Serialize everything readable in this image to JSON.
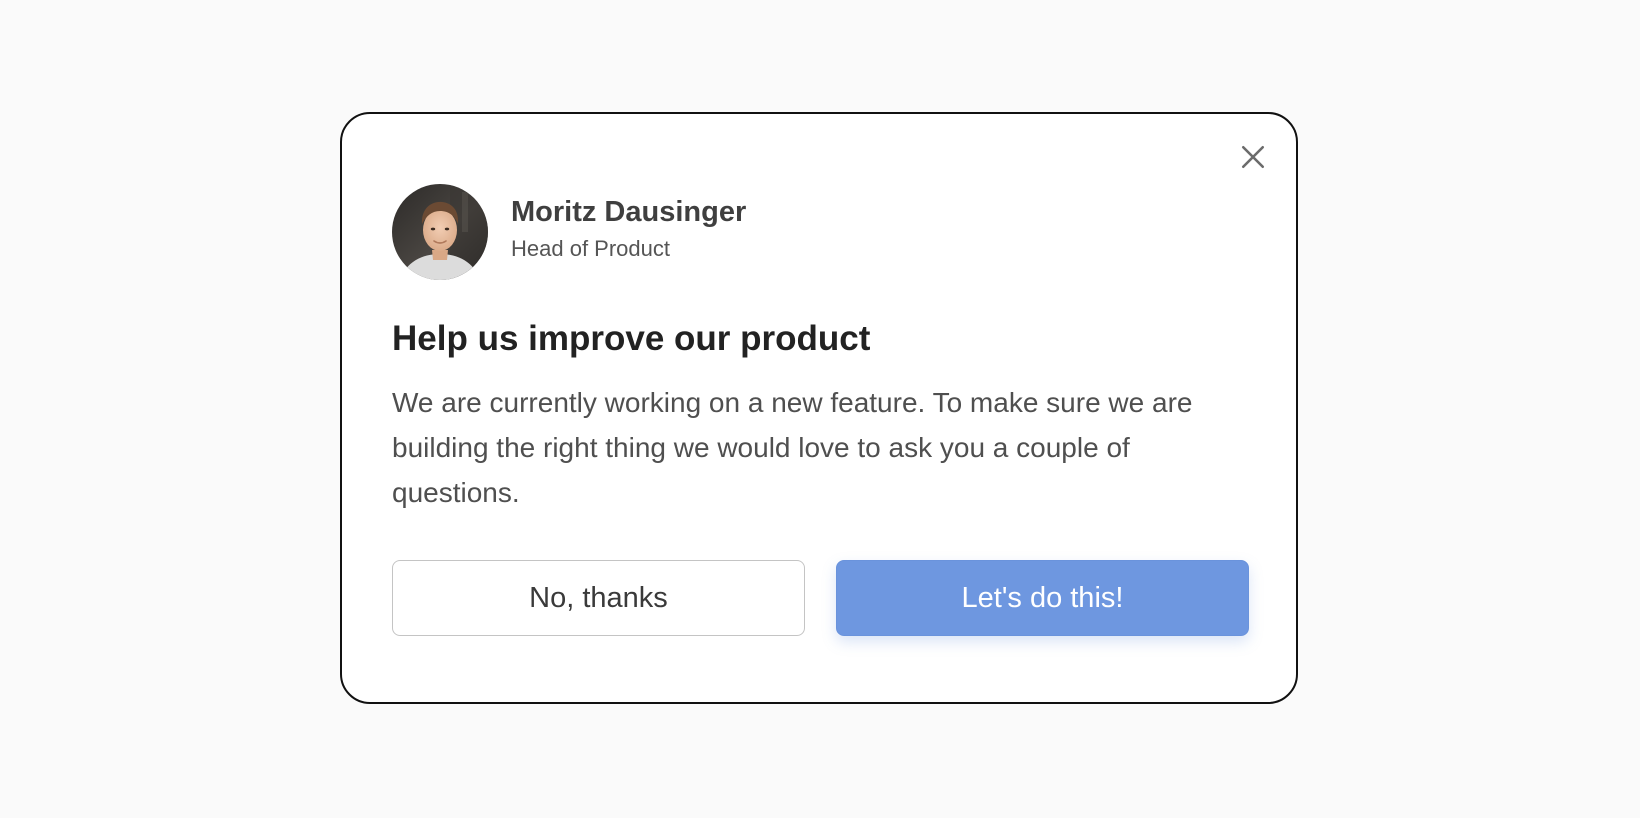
{
  "modal": {
    "close_icon": "close-icon",
    "author": {
      "avatar_icon": "avatar-photo",
      "name": "Moritz Dausinger",
      "role": "Head of Product"
    },
    "title": "Help us improve our product",
    "body": "We are currently working on a new feature. To make sure we are building the right thing we would love to ask you a couple of questions.",
    "buttons": {
      "decline_label": "No, thanks",
      "accept_label": "Let's do this!"
    }
  },
  "colors": {
    "background": "#fafafa",
    "modal_border": "#111111",
    "primary_button": "#6e97e0",
    "heading_text": "#222222",
    "body_text": "#4f4f4f"
  }
}
